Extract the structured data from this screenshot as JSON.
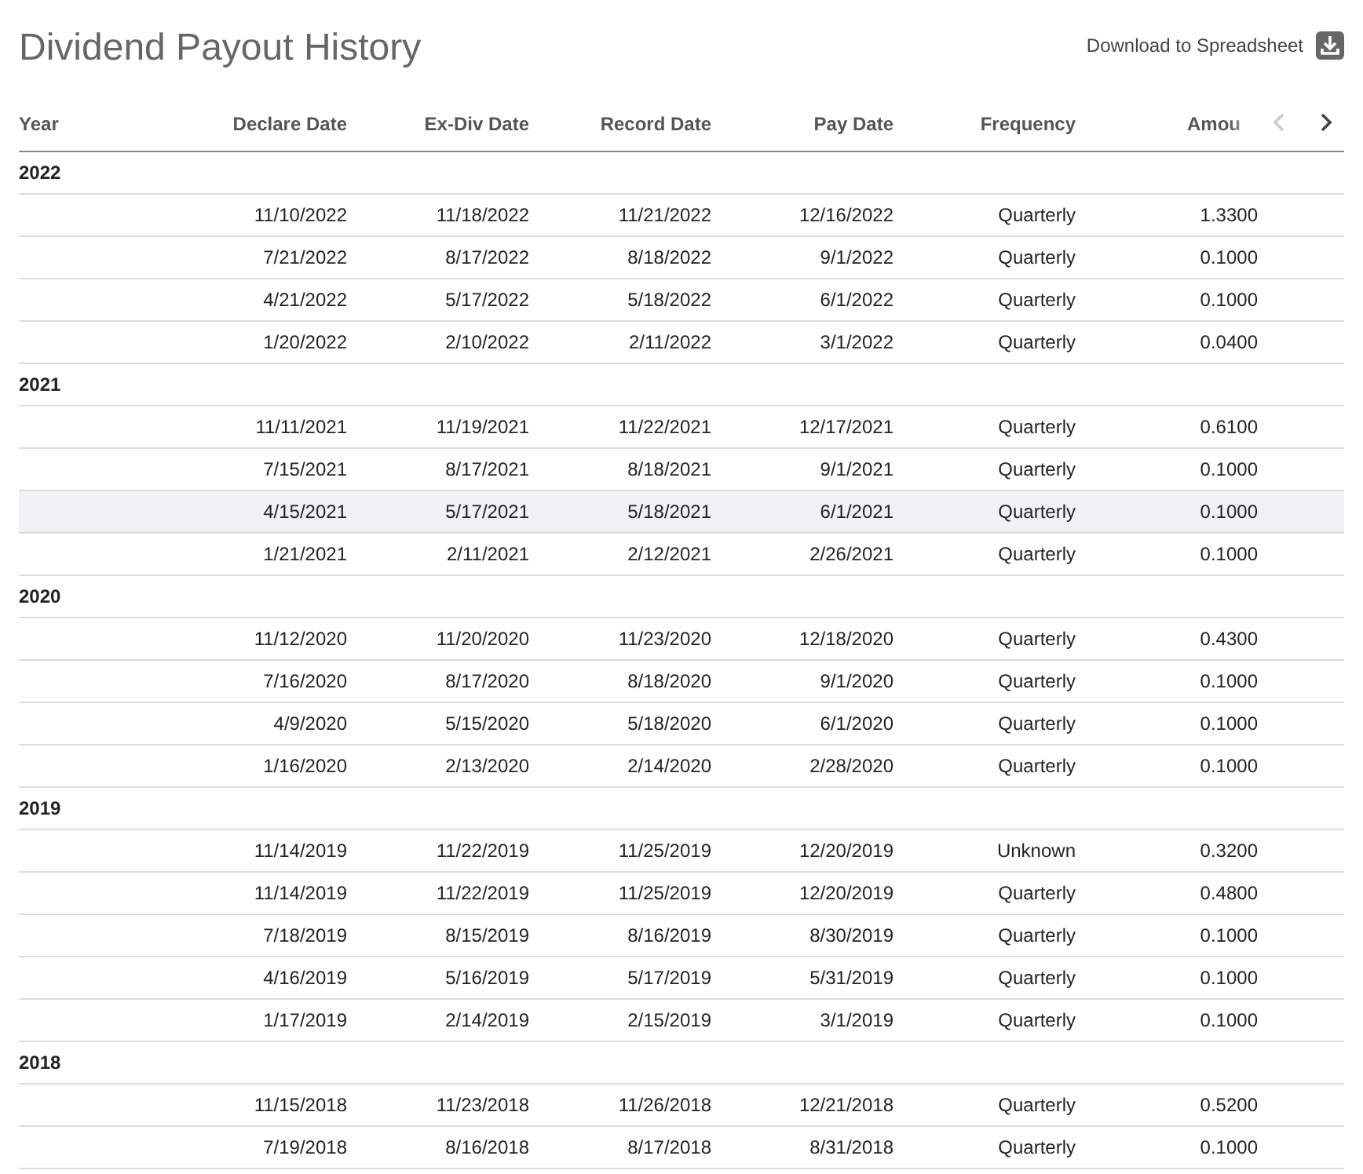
{
  "title": "Dividend Payout History",
  "download": {
    "label": "Download to Spreadsheet"
  },
  "columns": [
    "Year",
    "Declare Date",
    "Ex-Div Date",
    "Record Date",
    "Pay Date",
    "Frequency",
    "Amou"
  ],
  "pager": {
    "prev_disabled": true,
    "next_disabled": false
  },
  "groups": [
    {
      "year": "2022",
      "rows": [
        {
          "declare": "11/10/2022",
          "ex_div": "11/18/2022",
          "record": "11/21/2022",
          "pay": "12/16/2022",
          "frequency": "Quarterly",
          "amount": "1.3300",
          "selected": false
        },
        {
          "declare": "7/21/2022",
          "ex_div": "8/17/2022",
          "record": "8/18/2022",
          "pay": "9/1/2022",
          "frequency": "Quarterly",
          "amount": "0.1000",
          "selected": false
        },
        {
          "declare": "4/21/2022",
          "ex_div": "5/17/2022",
          "record": "5/18/2022",
          "pay": "6/1/2022",
          "frequency": "Quarterly",
          "amount": "0.1000",
          "selected": false
        },
        {
          "declare": "1/20/2022",
          "ex_div": "2/10/2022",
          "record": "2/11/2022",
          "pay": "3/1/2022",
          "frequency": "Quarterly",
          "amount": "0.0400",
          "selected": false
        }
      ]
    },
    {
      "year": "2021",
      "rows": [
        {
          "declare": "11/11/2021",
          "ex_div": "11/19/2021",
          "record": "11/22/2021",
          "pay": "12/17/2021",
          "frequency": "Quarterly",
          "amount": "0.6100",
          "selected": false
        },
        {
          "declare": "7/15/2021",
          "ex_div": "8/17/2021",
          "record": "8/18/2021",
          "pay": "9/1/2021",
          "frequency": "Quarterly",
          "amount": "0.1000",
          "selected": false
        },
        {
          "declare": "4/15/2021",
          "ex_div": "5/17/2021",
          "record": "5/18/2021",
          "pay": "6/1/2021",
          "frequency": "Quarterly",
          "amount": "0.1000",
          "selected": true
        },
        {
          "declare": "1/21/2021",
          "ex_div": "2/11/2021",
          "record": "2/12/2021",
          "pay": "2/26/2021",
          "frequency": "Quarterly",
          "amount": "0.1000",
          "selected": false
        }
      ]
    },
    {
      "year": "2020",
      "rows": [
        {
          "declare": "11/12/2020",
          "ex_div": "11/20/2020",
          "record": "11/23/2020",
          "pay": "12/18/2020",
          "frequency": "Quarterly",
          "amount": "0.4300",
          "selected": false
        },
        {
          "declare": "7/16/2020",
          "ex_div": "8/17/2020",
          "record": "8/18/2020",
          "pay": "9/1/2020",
          "frequency": "Quarterly",
          "amount": "0.1000",
          "selected": false
        },
        {
          "declare": "4/9/2020",
          "ex_div": "5/15/2020",
          "record": "5/18/2020",
          "pay": "6/1/2020",
          "frequency": "Quarterly",
          "amount": "0.1000",
          "selected": false
        },
        {
          "declare": "1/16/2020",
          "ex_div": "2/13/2020",
          "record": "2/14/2020",
          "pay": "2/28/2020",
          "frequency": "Quarterly",
          "amount": "0.1000",
          "selected": false
        }
      ]
    },
    {
      "year": "2019",
      "rows": [
        {
          "declare": "11/14/2019",
          "ex_div": "11/22/2019",
          "record": "11/25/2019",
          "pay": "12/20/2019",
          "frequency": "Unknown",
          "amount": "0.3200",
          "selected": false
        },
        {
          "declare": "11/14/2019",
          "ex_div": "11/22/2019",
          "record": "11/25/2019",
          "pay": "12/20/2019",
          "frequency": "Quarterly",
          "amount": "0.4800",
          "selected": false
        },
        {
          "declare": "7/18/2019",
          "ex_div": "8/15/2019",
          "record": "8/16/2019",
          "pay": "8/30/2019",
          "frequency": "Quarterly",
          "amount": "0.1000",
          "selected": false
        },
        {
          "declare": "4/16/2019",
          "ex_div": "5/16/2019",
          "record": "5/17/2019",
          "pay": "5/31/2019",
          "frequency": "Quarterly",
          "amount": "0.1000",
          "selected": false
        },
        {
          "declare": "1/17/2019",
          "ex_div": "2/14/2019",
          "record": "2/15/2019",
          "pay": "3/1/2019",
          "frequency": "Quarterly",
          "amount": "0.1000",
          "selected": false
        }
      ]
    },
    {
      "year": "2018",
      "rows": [
        {
          "declare": "11/15/2018",
          "ex_div": "11/23/2018",
          "record": "11/26/2018",
          "pay": "12/21/2018",
          "frequency": "Quarterly",
          "amount": "0.5200",
          "selected": false
        },
        {
          "declare": "7/19/2018",
          "ex_div": "8/16/2018",
          "record": "8/17/2018",
          "pay": "8/31/2018",
          "frequency": "Quarterly",
          "amount": "0.1000",
          "selected": false
        }
      ]
    }
  ]
}
